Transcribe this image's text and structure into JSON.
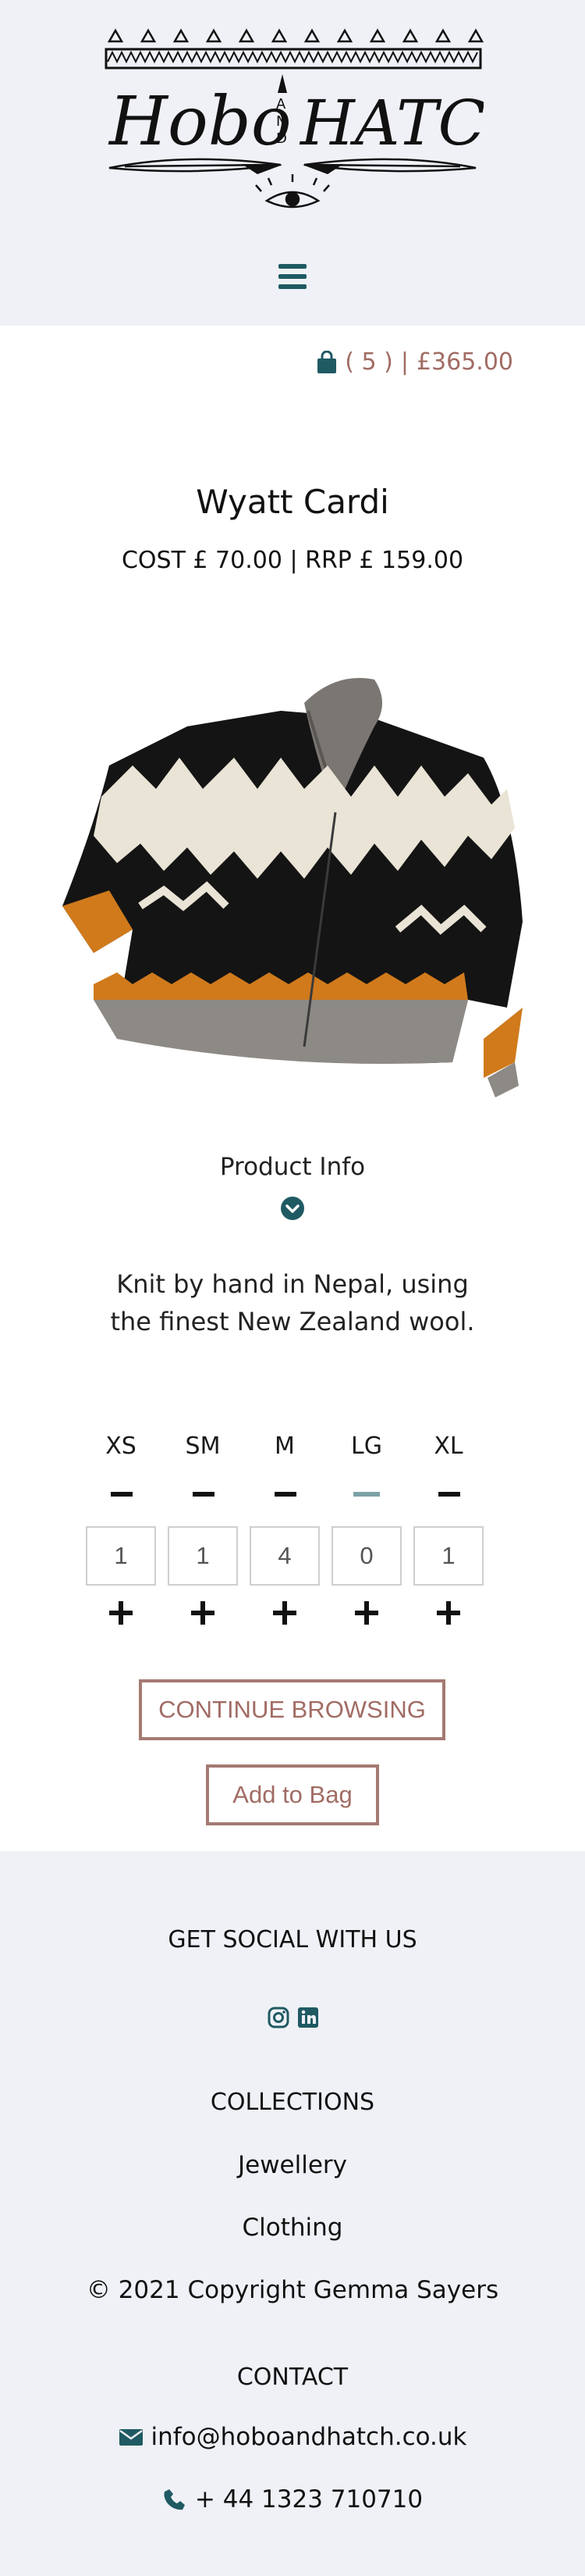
{
  "header": {
    "logo_alt": "Hobo AND HATCH",
    "logo_word_left": "Hobo",
    "logo_word_mid": "AND",
    "logo_word_right": "HATCH"
  },
  "cart": {
    "count_text": "( 5 )",
    "separator": "|",
    "total": "£365.00"
  },
  "product": {
    "title": "Wyatt Cardi",
    "price_line": "COST £ 70.00 | RRP £ 159.00",
    "info_label": "Product Info",
    "description": "Knit by hand in Nepal, using the finest New Zealand wool."
  },
  "sizes": [
    {
      "label": "XS",
      "qty": "1"
    },
    {
      "label": "SM",
      "qty": "1"
    },
    {
      "label": "M",
      "qty": "4"
    },
    {
      "label": "LG",
      "qty": "0"
    },
    {
      "label": "XL",
      "qty": "1"
    }
  ],
  "buttons": {
    "continue": "CONTINUE BROWSING",
    "add": "Add to Bag"
  },
  "footer": {
    "social_heading": "GET SOCIAL WITH US",
    "collections_heading": "COLLECTIONS",
    "collections": [
      "Jewellery",
      "Clothing"
    ],
    "copyright": "© 2021 Copyright Gemma Sayers",
    "contact_heading": "CONTACT",
    "email": "info@hoboandhatch.co.uk",
    "phone": "+ 44 1323 710710"
  },
  "colors": {
    "accent_teal": "#1f5a63",
    "accent_rose": "#a16c64",
    "footer_bg": "#eff1f6"
  }
}
